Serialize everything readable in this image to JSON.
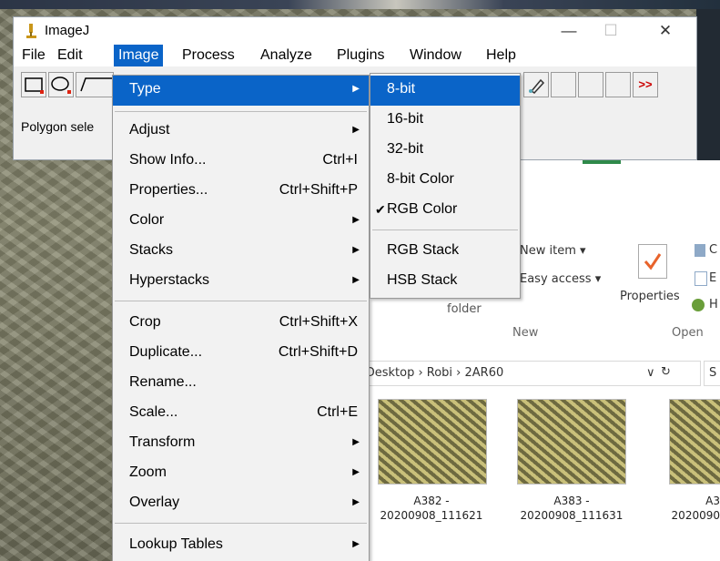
{
  "window": {
    "title": "ImageJ",
    "minimize_glyph": "—",
    "maximize_glyph": "☐",
    "close_glyph": "✕"
  },
  "menubar": [
    "File",
    "Edit",
    "Image",
    "Process",
    "Analyze",
    "Plugins",
    "Window",
    "Help"
  ],
  "toolbar": {
    "more_label": ">>"
  },
  "status_text": "Polygon sele",
  "image_menu": {
    "items": [
      {
        "label": "Type",
        "submenu": true,
        "highlighted": true
      },
      {
        "label": "Adjust",
        "submenu": true
      },
      {
        "label": "Show Info...",
        "shortcut": "Ctrl+I"
      },
      {
        "label": "Properties...",
        "shortcut": "Ctrl+Shift+P"
      },
      {
        "label": "Color",
        "submenu": true
      },
      {
        "label": "Stacks",
        "submenu": true
      },
      {
        "label": "Hyperstacks",
        "submenu": true
      },
      {
        "label": "Crop",
        "shortcut": "Ctrl+Shift+X"
      },
      {
        "label": "Duplicate...",
        "shortcut": "Ctrl+Shift+D"
      },
      {
        "label": "Rename..."
      },
      {
        "label": "Scale...",
        "shortcut": "Ctrl+E"
      },
      {
        "label": "Transform",
        "submenu": true
      },
      {
        "label": "Zoom",
        "submenu": true
      },
      {
        "label": "Overlay",
        "submenu": true
      },
      {
        "label": "Lookup Tables",
        "submenu": true
      }
    ]
  },
  "type_submenu": {
    "items": [
      {
        "label": "8-bit",
        "highlighted": true
      },
      {
        "label": "16-bit"
      },
      {
        "label": "32-bit"
      },
      {
        "label": "8-bit Color"
      },
      {
        "label": "RGB Color",
        "checked": true
      },
      {
        "label": "RGB Stack"
      },
      {
        "label": "HSB Stack"
      }
    ],
    "check_glyph": "✔"
  },
  "explorer": {
    "new_item": "New item ▾",
    "easy_access": "Easy access ▾",
    "folder": "folder",
    "group_new": "New",
    "properties": "Properties",
    "group_open": "Open",
    "ribbon_right_c": "C",
    "ribbon_right_e": "E",
    "ribbon_right_h": "H",
    "address": "n  ›  Desktop  ›  Robi  ›  2AR60",
    "address_chevron": "∨",
    "address_refresh": "↻",
    "search_fragment": "S",
    "thumbnails": [
      {
        "name": "A382 -",
        "date": "20200908_111621"
      },
      {
        "name": "A383 -",
        "date": "20200908_111631"
      },
      {
        "name": "A3",
        "date": "2020090"
      }
    ]
  },
  "colors": {
    "highlight": "#0a64c8",
    "menu_bg": "#f2f2f2"
  }
}
